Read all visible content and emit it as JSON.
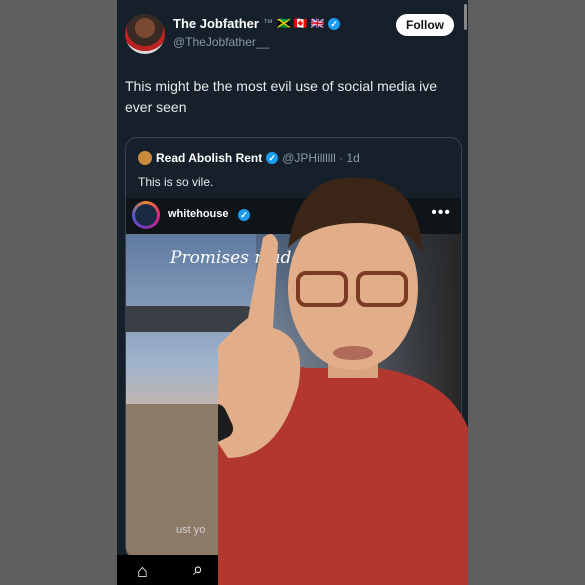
{
  "tweet": {
    "author_name": "The Jobfather",
    "trademark": "™",
    "flags": "🇯🇲 🇨🇦 🇬🇧",
    "verified_mark": "✓",
    "handle": "@TheJobfather__",
    "follow_label": "Follow",
    "text": "This might be the most evil use of social media ive ever seen"
  },
  "quote": {
    "author_name": "Read Abolish Rent",
    "verified_mark": "✓",
    "handle_time": "@JPHillllll · 1d",
    "text": "This is so vile.",
    "instagram": {
      "account": "whitehouse",
      "verified_mark": "✓",
      "more": "•••",
      "video_title": "Promises made",
      "caption_fragment": "ust yo"
    }
  },
  "tabbar": {
    "home_icon": "⌂",
    "search_icon": "⌕"
  },
  "colors": {
    "background": "#15202b",
    "accent": "#1d9bf0",
    "outer": "#5f5f5f"
  }
}
